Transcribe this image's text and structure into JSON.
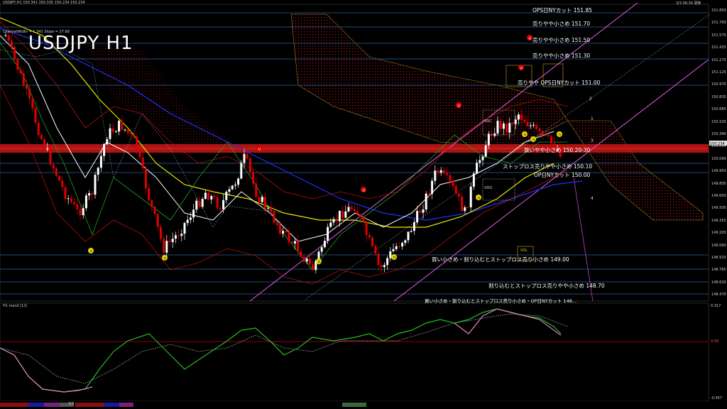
{
  "header": {
    "symbol_line": "USDJPY,H1 150.341 150.335 150.234 150.234",
    "indicator_line": "ChannelWidth = 1.341 Slope = 27.68",
    "timestamp": "3/3 06:39 更新",
    "macd_label": "H1 macd (12)"
  },
  "title": "USDJPY H1",
  "levels": [
    {
      "label": "OPS日NYカット 151.85"
    },
    {
      "label": "売りやや小さめ 151.70"
    },
    {
      "label": "売りやや小さめ 151.50"
    },
    {
      "label": "売りやや小さめ 151.30"
    },
    {
      "label": "売りやや OPS日NYカット 151.00"
    },
    {
      "label": "買いやや小さめ 150.20-30"
    },
    {
      "label": "ストップロス売りやや小さめ 150.10"
    },
    {
      "label": "OP日NYカット 150.00"
    },
    {
      "label": "買い小さめ・割り込むとストップロス売り小さめ 149.00"
    },
    {
      "label": "割り込むとストップロス売りやや小さめ 148.70"
    },
    {
      "label": "買い小さめ・割り込むとストップロス売り小さめ・OP日NYカット 148..."
    }
  ],
  "price_axis": [
    "151.850",
    "151.700",
    "151.575",
    "151.425",
    "151.275",
    "151.125",
    "150.970",
    "150.835",
    "150.685",
    "150.535",
    "150.390",
    "150.234",
    "150.090",
    "149.950",
    "149.805",
    "149.650",
    "149.505",
    "149.355",
    "149.205",
    "149.060",
    "148.910",
    "148.765",
    "148.620",
    "148.470"
  ],
  "current_price": "150.234",
  "macd_axis": {
    "top": "0.317",
    "zero": "0.00",
    "bottom": "-0.457"
  },
  "channel_marks": [
    "2",
    "1",
    "3",
    "4"
  ],
  "markers": {
    "vdc": "VDC",
    "vdo": "VDO",
    "vdl": "VDL"
  },
  "timeframe_label": "3/3",
  "colors": {
    "bull": "#ffffff",
    "bear": "#e00000",
    "band": "#cc0000",
    "ma_yellow": "#e6e600",
    "ma_blue": "#2030ff",
    "ma_white": "#ffffff",
    "channel": "#e050e0",
    "level_line": "#2a5a9a",
    "cloud": "#d01010"
  }
}
